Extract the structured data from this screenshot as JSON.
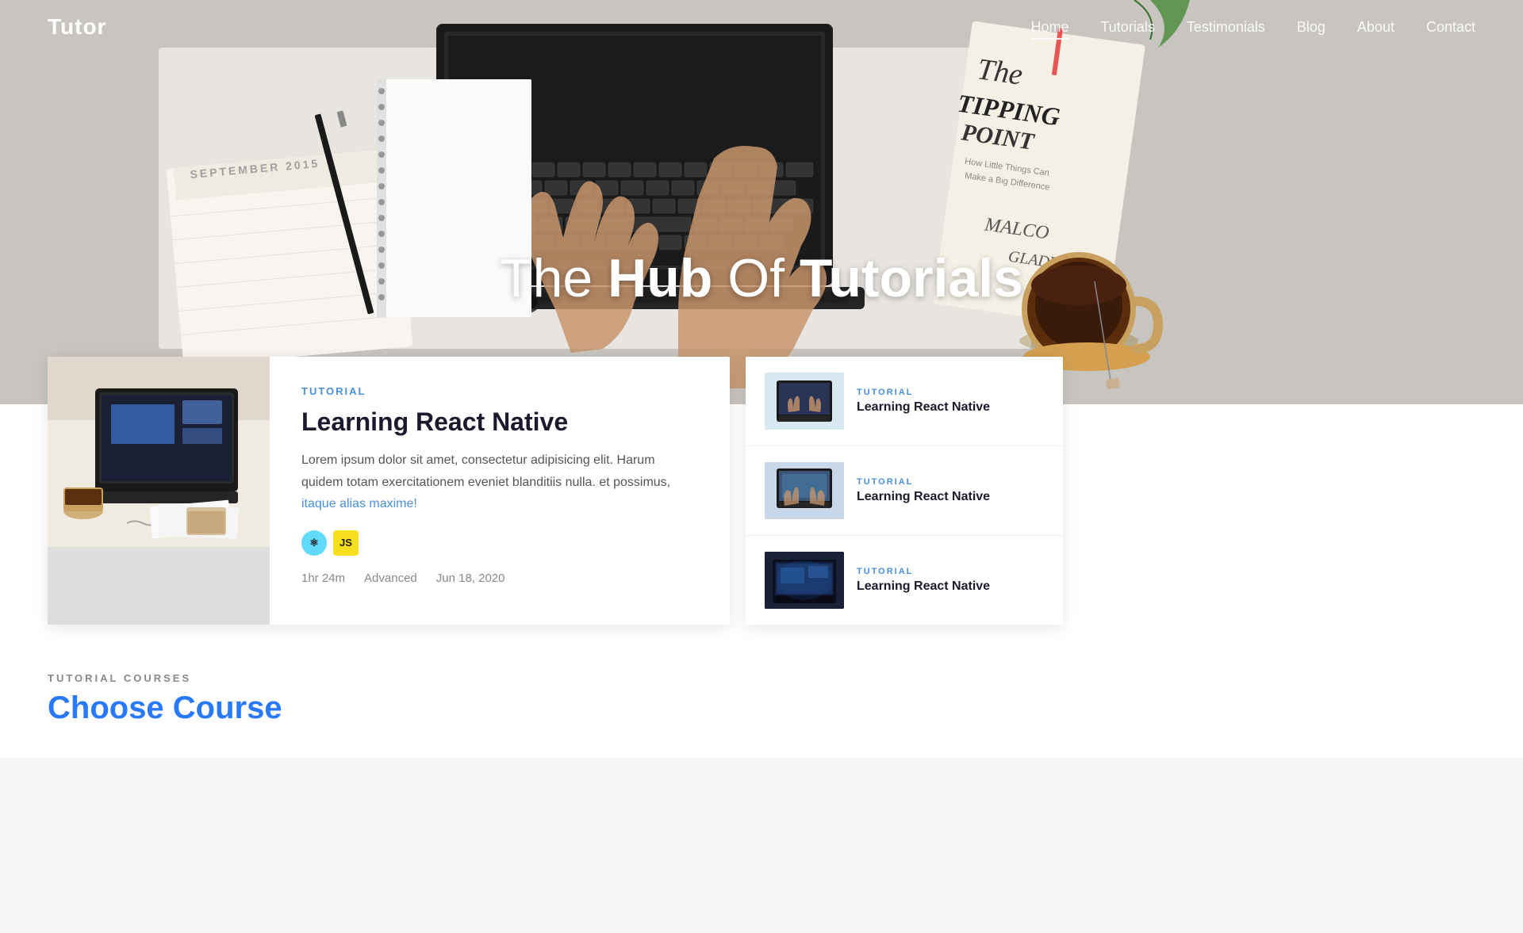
{
  "brand": {
    "logo": "Tutor"
  },
  "navbar": {
    "links": [
      {
        "label": "Home",
        "active": true
      },
      {
        "label": "Tutorials",
        "active": false
      },
      {
        "label": "Testimonials",
        "active": false
      },
      {
        "label": "Blog",
        "active": false
      },
      {
        "label": "About",
        "active": false
      },
      {
        "label": "Contact",
        "active": false
      }
    ]
  },
  "hero": {
    "title_start": "The ",
    "title_bold1": "Hub",
    "title_middle": " Of ",
    "title_bold2": "Tutorials"
  },
  "main_card": {
    "badge": "TUTORIAL",
    "title": "Learning React Native",
    "description": "Lorem ipsum dolor sit amet, consectetur adipisicing elit. Harum quidem totam exercitationem eveniet blanditiis nulla. et possimus,",
    "description_link": "itaque alias maxime!",
    "tags": [
      {
        "name": "React",
        "symbol": "⚛",
        "class": "react"
      },
      {
        "name": "JavaScript",
        "symbol": "JS",
        "class": "js"
      }
    ],
    "meta": {
      "duration": "1hr 24m",
      "level": "Advanced",
      "date": "Jun 18, 2020"
    }
  },
  "side_cards": [
    {
      "badge": "TUTORIAL",
      "title": "Learning React Native",
      "image_class": "side-img-1"
    },
    {
      "badge": "TUTORIAL",
      "title": "Learning React Native",
      "image_class": "side-img-2"
    },
    {
      "badge": "TUTORIAL",
      "title": "Learning React Native",
      "image_class": "side-img-3"
    }
  ],
  "courses_section": {
    "label": "TUTORIAL COURSES",
    "title": "Choose Course"
  }
}
